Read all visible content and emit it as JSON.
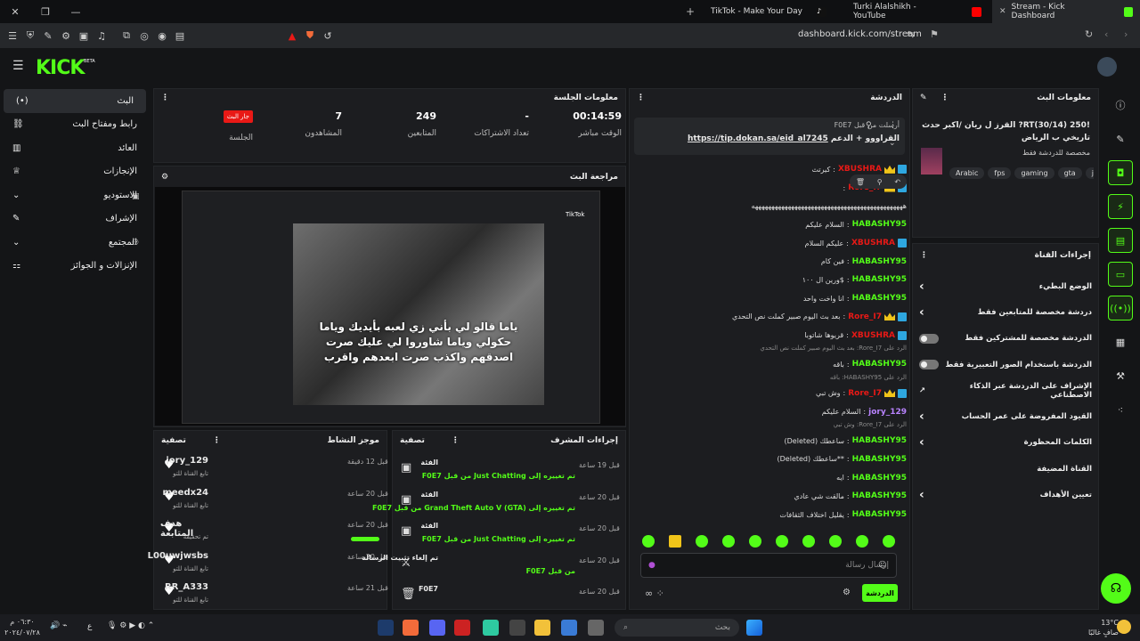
{
  "browser": {
    "tabs": [
      {
        "label": "TikTok - Make Your Day"
      },
      {
        "label": "Turki Alalshikh - YouTube"
      },
      {
        "label": "Stream - Kick Dashboard"
      }
    ],
    "url": "dashboard.kick.com/stream"
  },
  "app": {
    "logo": "KICK",
    "beta": "BETA"
  },
  "sidebar": {
    "items": [
      {
        "label": "البث"
      },
      {
        "label": "رابط ومفتاح البث"
      },
      {
        "label": "العائد"
      },
      {
        "label": "الإنجازات"
      },
      {
        "label": "الاستوديو"
      },
      {
        "label": "الإشراف"
      },
      {
        "label": "المجتمع"
      },
      {
        "label": "الإنزالات و الجوائز"
      }
    ]
  },
  "session": {
    "title": "معلومات الجلسة",
    "live_badge": "جار البث",
    "session_label": "الجلسة",
    "viewers": "7",
    "viewers_label": "المشاهدون",
    "followers": "249",
    "followers_label": "المتابعين",
    "subs": "-",
    "subs_label": "تعداد الاشتراكات",
    "time": "00:14:59",
    "time_label": "الوقت مباشر"
  },
  "preview": {
    "title": "مراجعة البث",
    "caption": "ياما قالو لي بأني زي لعبه بأيديك وياما حكولي وياما شاوروا لي عليك صرت اصدقهم واكذب صرت ابعدهم واقرب",
    "tiktok": "TikTok"
  },
  "activity": {
    "title": "موجز النشاط",
    "filter": "تصفية",
    "rows": [
      {
        "user": "jory_129",
        "sub": "تابع القناة للتو",
        "time": "قبل 12 دقيقة"
      },
      {
        "user": "meedx24",
        "sub": "تابع القناة للتو",
        "time": "قبل 20 ساعة"
      },
      {
        "user": "هدف المتابعة",
        "sub": "تم تحقيقه",
        "time": "قبل 20 ساعة"
      },
      {
        "user": "L00uwjwsbs",
        "sub": "تابع القناة للتو",
        "time": "قبل 20 ساعة"
      },
      {
        "user": "RR_A333",
        "sub": "تابع القناة للتو",
        "time": "قبل 21 ساعة"
      }
    ]
  },
  "modactions": {
    "title": "إجراءات المشرف",
    "filter": "تصفية",
    "rows": [
      {
        "title": "الفئة",
        "time": "قبل 19 ساعة",
        "desc": "تم تغييره إلى Just Chatting من قبل F0E7"
      },
      {
        "title": "الفئة",
        "time": "قبل 20 ساعة",
        "desc": "تم تغييره إلى Grand Theft Auto V (GTA) من قبل F0E7"
      },
      {
        "title": "الفئة",
        "time": "قبل 20 ساعة",
        "desc": "تم تغييره إلى Just Chatting من قبل F0E7"
      },
      {
        "title": "تم إلغاء تثبيت الرسالة",
        "time": "قبل 20 ساعة",
        "desc": "من قبل F0E7"
      },
      {
        "title": "F0E7",
        "time": "قبل 20 ساعة",
        "desc": ""
      }
    ]
  },
  "chat": {
    "title": "الدردشة",
    "pinned_by": "أرسلت من قبل F0E7",
    "pinned_text": "القراووو + الدعم",
    "pinned_link": "https://tip.dokan.sa/eid_al7245",
    "input_placeholder": "إرسال رسالة",
    "send": "الدردشة",
    "messages": [
      {
        "user": "XBUSHRA",
        "color": "#e91916",
        "text": "كيرتث",
        "badge": true,
        "crown": true
      },
      {
        "user": "Rore_I7",
        "color": "#e91916",
        "text": "",
        "badge": true,
        "crown": true
      },
      {
        "user": "",
        "color": "#ddd",
        "text": "ههههههههههههههههههههههههههههههههههههههههههههههه",
        "badge": false,
        "crown": false
      },
      {
        "user": "HABASHY95",
        "color": "#53fc18",
        "text": "السلام عليكم",
        "badge": false,
        "crown": false
      },
      {
        "user": "XBUSHRA",
        "color": "#e91916",
        "text": "عليكم السلام",
        "badge": true,
        "crown": false
      },
      {
        "user": "HABASHY95",
        "color": "#53fc18",
        "text": "فين كام",
        "badge": false,
        "crown": false
      },
      {
        "user": "HABASHY95",
        "color": "#53fc18",
        "text": "$ورين ال ١٠٠",
        "badge": false,
        "crown": false
      },
      {
        "user": "HABASHY95",
        "color": "#53fc18",
        "text": "انا واخت واحد",
        "badge": false,
        "crown": false
      },
      {
        "user": "Rore_I7",
        "color": "#e91916",
        "text": "بعد بث اليوم صبير كملت نص التحدي",
        "badge": true,
        "crown": true
      },
      {
        "user": "XBUSHRA",
        "color": "#e91916",
        "text": "قريوها شاتوبا",
        "badge": true,
        "crown": false
      },
      {
        "user": "HABASHY95",
        "color": "#53fc18",
        "text": "باقه",
        "badge": false,
        "crown": false,
        "reply": "الرد على Rore_I7: بعد بث اليوم صبير كملت نص التحدي"
      },
      {
        "user": "Rore_I7",
        "color": "#e91916",
        "text": "وش تبي",
        "badge": true,
        "crown": true,
        "reply": "الرد على HABASHY95: باقه"
      },
      {
        "user": "jory_129",
        "color": "#b983ff",
        "text": "السلام عليكم",
        "badge": false,
        "crown": false
      },
      {
        "user": "HABASHY95",
        "color": "#53fc18",
        "text": "ساعطك (Deleted)",
        "badge": false,
        "crown": false,
        "reply": "الرد على Rore_I7: وش تبي"
      },
      {
        "user": "HABASHY95",
        "color": "#53fc18",
        "text": "**ساعطك (Deleted)",
        "badge": false,
        "crown": false
      },
      {
        "user": "HABASHY95",
        "color": "#53fc18",
        "text": "ايه",
        "badge": false,
        "crown": false
      },
      {
        "user": "HABASHY95",
        "color": "#53fc18",
        "text": "مالقت شي عادي",
        "badge": false,
        "crown": false
      },
      {
        "user": "HABASHY95",
        "color": "#53fc18",
        "text": "يقليل اختلاف الثقافات",
        "badge": false,
        "crown": false
      }
    ]
  },
  "streaminfo": {
    "title": "معلومات البث",
    "stream_title": "!RT(30/14) 250? القرز ل ريان /اكبر حدث تاريخي ب الرياض",
    "category": "مخصصة للدردشة فقط",
    "tags": [
      "Arabic",
      "fps",
      "gaming",
      "gta",
      "just"
    ]
  },
  "channelactions": {
    "title": "إجراءات القناة",
    "items": [
      {
        "label": "الوضع البطيء",
        "type": "arrow"
      },
      {
        "label": "دردشة مخصصة للمتابعين فقط",
        "type": "arrow"
      },
      {
        "label": "الدردشة مخصصة للمشتركين فقط",
        "type": "toggle"
      },
      {
        "label": "الدردشة باستخدام الصور التعبيرية فقط",
        "type": "toggle"
      },
      {
        "label": "الإشراف على الدردشة عبر الذكاء الاصطناعي",
        "type": "ext"
      },
      {
        "label": "القيود المفروضة على عمر الحساب",
        "type": "arrow"
      },
      {
        "label": "الكلمات المحظورة",
        "type": "arrow"
      },
      {
        "label": "القناة المضيفة",
        "type": "none"
      },
      {
        "label": "تعيين الأهداف",
        "type": "arrow"
      }
    ]
  },
  "taskbar": {
    "search": "بحث",
    "weather_temp": "13°C",
    "weather_desc": "صافٍ غالبًا",
    "time": "٠٦:٣٠ م",
    "date": "٢٠٢٤/٠٧/٢٨",
    "lang": "ع"
  }
}
